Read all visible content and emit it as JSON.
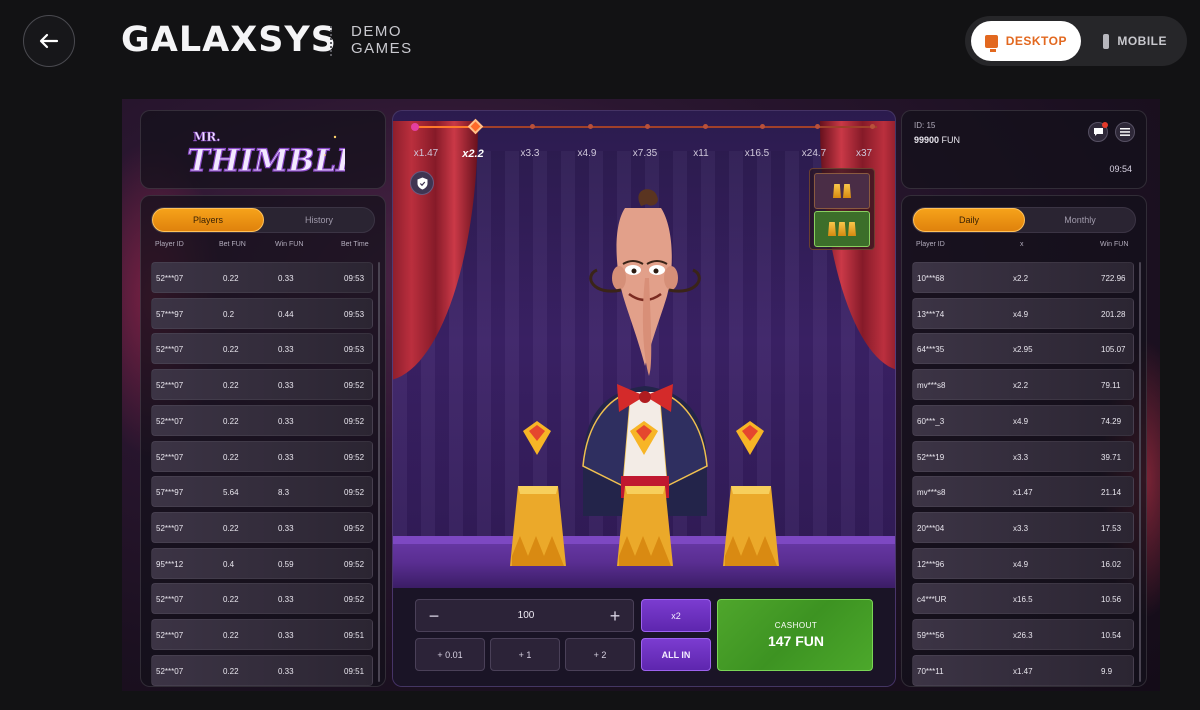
{
  "header": {
    "brand": "GALAXSYS",
    "subtitle_line1": "DEMO",
    "subtitle_line2": "GAMES",
    "desktop_label": "DESKTOP",
    "mobile_label": "MOBILE",
    "accent_color": "#e2681f"
  },
  "game": {
    "logo_text": "MR. THIMBLE",
    "multipliers": [
      "x1.47",
      "x2.2",
      "x3.3",
      "x4.9",
      "x7.35",
      "x11",
      "x16.5",
      "x24.7",
      "x37"
    ],
    "active_multiplier": "x2.2",
    "players_panel": {
      "tabs": [
        "Players",
        "History"
      ],
      "active_tab": "Players",
      "columns": [
        "Player ID",
        "Bet FUN",
        "Win FUN",
        "Bet Time"
      ],
      "rows": [
        [
          "52***07",
          "0.22",
          "0.33",
          "09:53"
        ],
        [
          "57***97",
          "0.2",
          "0.44",
          "09:53"
        ],
        [
          "52***07",
          "0.22",
          "0.33",
          "09:53"
        ],
        [
          "52***07",
          "0.22",
          "0.33",
          "09:52"
        ],
        [
          "52***07",
          "0.22",
          "0.33",
          "09:52"
        ],
        [
          "52***07",
          "0.22",
          "0.33",
          "09:52"
        ],
        [
          "57***97",
          "5.64",
          "8.3",
          "09:52"
        ],
        [
          "52***07",
          "0.22",
          "0.33",
          "09:52"
        ],
        [
          "95***12",
          "0.4",
          "0.59",
          "09:52"
        ],
        [
          "52***07",
          "0.22",
          "0.33",
          "09:52"
        ],
        [
          "52***07",
          "0.22",
          "0.33",
          "09:51"
        ],
        [
          "52***07",
          "0.22",
          "0.33",
          "09:51"
        ]
      ]
    },
    "user": {
      "id_label": "ID: 15",
      "balance": "99900",
      "currency": "FUN",
      "time": "09:54"
    },
    "leaderboard": {
      "tabs": [
        "Daily",
        "Monthly"
      ],
      "active_tab": "Daily",
      "columns": [
        "Player ID",
        "x",
        "Win FUN"
      ],
      "rows": [
        [
          "10***68",
          "x2.2",
          "722.96"
        ],
        [
          "13***74",
          "x4.9",
          "201.28"
        ],
        [
          "64***35",
          "x2.95",
          "105.07"
        ],
        [
          "mv***s8",
          "x2.2",
          "79.11"
        ],
        [
          "60***_3",
          "x4.9",
          "74.29"
        ],
        [
          "52***19",
          "x3.3",
          "39.71"
        ],
        [
          "mv***s8",
          "x1.47",
          "21.14"
        ],
        [
          "20***04",
          "x3.3",
          "17.53"
        ],
        [
          "12***96",
          "x4.9",
          "16.02"
        ],
        [
          "c4***UR",
          "x16.5",
          "10.56"
        ],
        [
          "59***56",
          "x26.3",
          "10.54"
        ],
        [
          "70***11",
          "x1.47",
          "9.9"
        ]
      ]
    },
    "controls": {
      "bet_value": "100",
      "minus": "−",
      "plus": "+",
      "x2_label": "x2",
      "quick_bets": [
        "+ 0.01",
        "+ 1",
        "+ 2"
      ],
      "all_in_label": "ALL IN",
      "cashout_label": "CASHOUT",
      "cashout_amount": "147 FUN"
    }
  }
}
